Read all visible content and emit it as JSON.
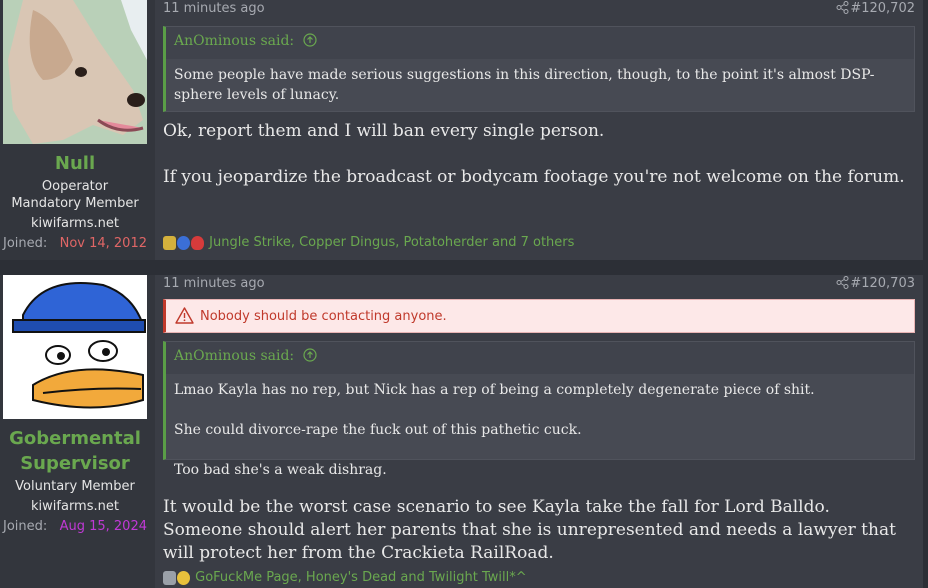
{
  "posts": [
    {
      "user": {
        "name": "Null",
        "title_lines": [
          "Ooperator",
          "Mandatory Member",
          "kiwifarms.net"
        ],
        "joined_label": "Joined:",
        "joined_date": "Nov 14, 2012",
        "joined_color": "#e06666"
      },
      "time": "11 minutes ago",
      "number": "#120,702",
      "quote": {
        "author": "AnOminous said:",
        "text": "Some people have made serious suggestions in this direction, though, to the point it's almost DSP-sphere levels of lunacy."
      },
      "body": [
        "Ok, report them and I will ban every single person.",
        "If you jeopardize the broadcast or bodycam footage you're not welcome on the forum."
      ],
      "reactions": "Jungle Strike, Copper Dingus, Potatoherder and 7 others"
    },
    {
      "user": {
        "name": "Gobermental Supervisor",
        "title_lines": [
          "Voluntary Member",
          "kiwifarms.net"
        ],
        "joined_label": "Joined:",
        "joined_date": "Aug 15, 2024",
        "joined_color": "#c039d6"
      },
      "time": "11 minutes ago",
      "number": "#120,703",
      "warning": "Nobody should be contacting anyone.",
      "quote": {
        "author": "AnOminous said:",
        "lines": [
          "Lmao Kayla has no rep, but Nick has a rep of being a completely degenerate piece of shit.",
          "She could divorce-rape the fuck out of this pathetic cuck.",
          "Too bad she's a weak dishrag."
        ]
      },
      "body": [
        "It would be the worst case scenario to see Kayla take the fall for Lord Balldo. Someone should alert her parents that she is unrepresented and needs a lawyer that will protect her from the Crackieta RailRoad."
      ],
      "reactions": "GoFuckMe Page, Honey's Dead and Twilight Twill*^"
    }
  ]
}
